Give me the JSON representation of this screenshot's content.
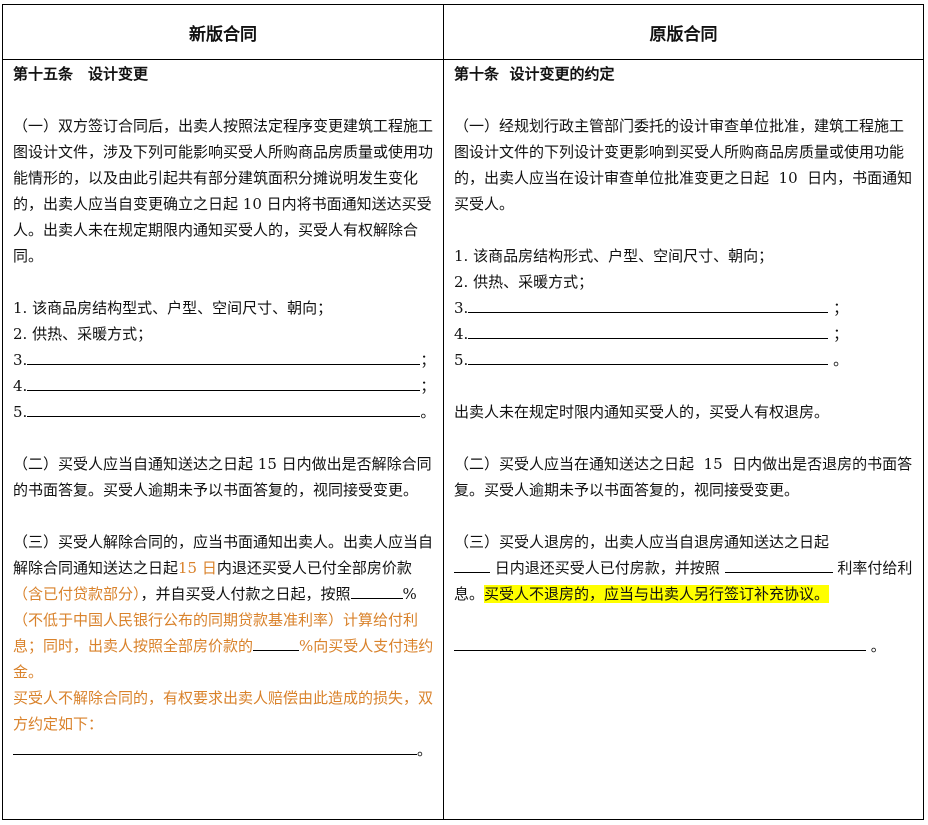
{
  "header": {
    "left": "新版合同",
    "right": "原版合同"
  },
  "left": {
    "title": "第十五条　设计变更",
    "p1": "（一）双方签订合同后，出卖人按照法定程序变更建筑工程施工图设计文件，涉及下列可能影响买受人所购商品房质量或使用功能情形的，以及由此引起共有部分建筑面积分摊说明发生变化的，出卖人应当自变更确立之日起 10 日内将书面通知送达买受人。出卖人未在规定期限内通知买受人的，买受人有权解除合同。",
    "item1": "1. 该商品房结构型式、户型、空间尺寸、朝向；",
    "item2": "2. 供热、采暖方式；",
    "item3": "3.",
    "item4": "4.",
    "item5": "5.",
    "end_semicolon": "；",
    "end_period": "。",
    "p2": "（二）买受人应当自通知送达之日起 15 日内做出是否解除合同的书面答复。买受人逾期未予以书面答复的，视同接受变更。",
    "p3a": "（三）买受人解除合同的，应当书面通知出卖人。出卖人应当自解除合同通知送达之日起",
    "p3b": "15 日",
    "p3c": "内退还买受人已付全部房价款",
    "p3d": "（含已付贷款部分）",
    "p3e": "，并自买受人付款之日起，按照",
    "p3f": "%",
    "p3g": "（不低于中国人民银行公布的同期贷款基准利率）计算给付利息；同时，出卖人按照全部房价款的",
    "p3h": "%向买受人支付违约金。",
    "p4": "买受人不解除合同的，有权要求出卖人赔偿由此造成的损失，双方约定如下："
  },
  "right": {
    "title": "第十条  设计变更的约定",
    "p1": "（一）经规划行政主管部门委托的设计审查单位批准，建筑工程施工图设计文件的下列设计变更影响到买受人所购商品房质量或使用功能的，出卖人应当在设计审查单位批准变更之日起  10  日内，书面通知买受人。",
    "item1": "1. 该商品房结构形式、户型、空间尺寸、朝向；",
    "item2": "2. 供热、采暖方式；",
    "item3": "3.",
    "item4": "4.",
    "item5": "5.",
    "end_semicolon": "；",
    "end_period": "。",
    "p_late": "出卖人未在规定时限内通知买受人的，买受人有权退房。",
    "p2": "（二）买受人应当在通知送达之日起  15  日内做出是否退房的书面答复。买受人逾期未予以书面答复的，视同接受变更。",
    "p3a": "（三）买受人退房的，出卖人应当自退房通知送达之日起",
    "p3b": "日内退还买受人已付房款，并按照",
    "p3c": "利率付给利息。",
    "p3d": "买受人不退房的，应当与出卖人另行签订补充协议。"
  }
}
